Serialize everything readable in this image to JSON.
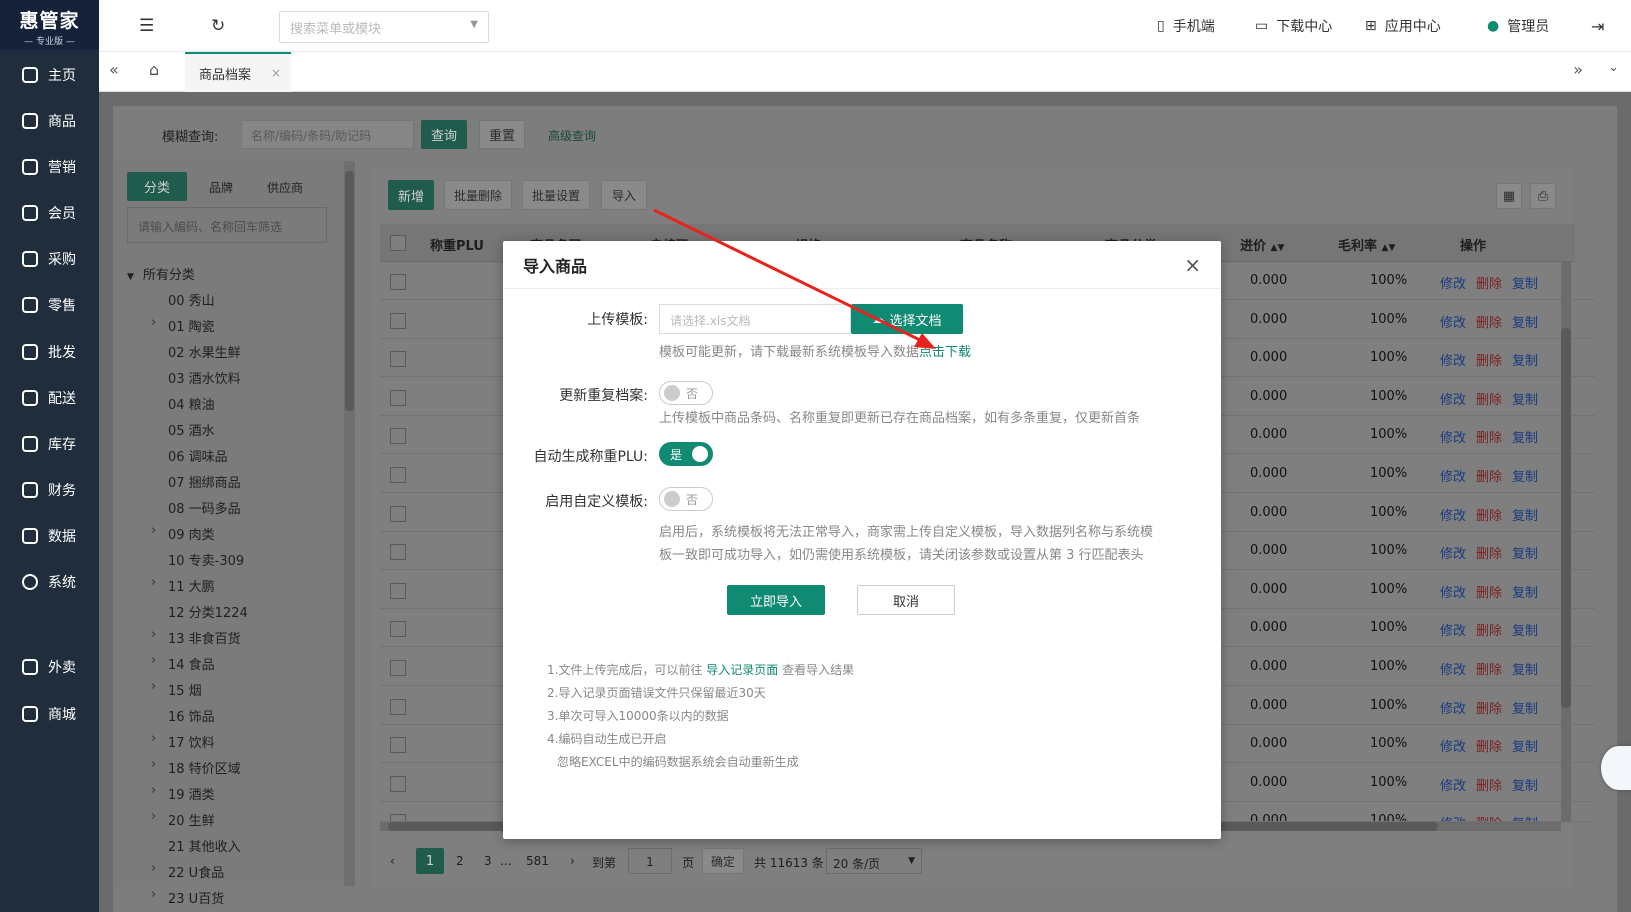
{
  "app": {
    "logo_main": "惠管家",
    "logo_sub": "— 专业版 —"
  },
  "sidebar": {
    "items": [
      {
        "label": "主页",
        "icon": "home-icon"
      },
      {
        "label": "商品",
        "icon": "cube-icon"
      },
      {
        "label": "营销",
        "icon": "chart-icon"
      },
      {
        "label": "会员",
        "icon": "heart-icon"
      },
      {
        "label": "采购",
        "icon": "purchase-icon"
      },
      {
        "label": "零售",
        "icon": "bag-icon"
      },
      {
        "label": "批发",
        "icon": "building-icon"
      },
      {
        "label": "配送",
        "icon": "delivery-icon"
      },
      {
        "label": "库存",
        "icon": "inventory-icon"
      },
      {
        "label": "财务",
        "icon": "finance-icon"
      },
      {
        "label": "数据",
        "icon": "data-icon"
      },
      {
        "label": "系统",
        "icon": "settings-icon"
      },
      {
        "label": "外卖",
        "icon": "bike-icon"
      },
      {
        "label": "商城",
        "icon": "mall-icon"
      }
    ]
  },
  "header": {
    "search_placeholder": "搜索菜单或模块",
    "mobile": "手机端",
    "download": "下载中心",
    "apps": "应用中心",
    "user": "管理员"
  },
  "tabs": {
    "active": "商品档案"
  },
  "filter": {
    "label": "模糊查询:",
    "placeholder": "名称/编码/条码/助记码",
    "query": "查询",
    "reset": "重置",
    "advanced": "高级查询"
  },
  "left_panel": {
    "tabs": [
      "分类",
      "品牌",
      "供应商"
    ],
    "search_placeholder": "请输入编码、名称回车筛选",
    "root": "所有分类",
    "categories": [
      "00 秀山",
      "01 陶瓷",
      "02 水果生鲜",
      "03 酒水饮料",
      "04 粮油",
      "05 酒水",
      "06 调味品",
      "07 捆绑商品",
      "08 一码多品",
      "09 肉类",
      "10 专卖-309",
      "11 大鹏",
      "12 分类1224",
      "13 非食百货",
      "14 食品",
      "15 烟",
      "16 饰品",
      "17 饮料",
      "18 特价区域",
      "19 酒类",
      "20 生鲜",
      "21 其他收入",
      "22 U食品",
      "23 U百货"
    ]
  },
  "toolbar": {
    "add": "新增",
    "batch_delete": "批量删除",
    "batch_set": "批量设置",
    "import": "导入"
  },
  "table": {
    "columns": [
      "称重PLU",
      "商品条码",
      "自编码",
      "规格",
      "商品名称",
      "商品分类",
      "进价",
      "毛利率",
      "操作"
    ],
    "row_cost": "0.000",
    "row_margin": "100%",
    "actions": [
      "修改",
      "删除",
      "复制"
    ]
  },
  "pagination": {
    "pages": [
      "1",
      "2",
      "3",
      "...",
      "581"
    ],
    "goto_label": "到第",
    "goto_value": "1",
    "page_suffix": "页",
    "confirm": "确定",
    "total": "共 11613 条",
    "page_size": "20 条/页"
  },
  "modal": {
    "title": "导入商品",
    "upload_label": "上传模板:",
    "upload_placeholder": "请选择.xls文档",
    "choose_btn": "选择文档",
    "template_hint": "模板可能更新，请下载最新系统模板导入数据",
    "download_link": "点击下载",
    "update_label": "更新重复档案:",
    "update_value": "否",
    "update_hint": "上传模板中商品条码、名称重复即更新已存在商品档案，如有多条重复，仅更新首条",
    "plu_label": "自动生成称重PLU:",
    "plu_value": "是",
    "custom_label": "启用自定义模板:",
    "custom_value": "否",
    "custom_hint_1": "启用后，系统模板将无法正常导入，商家需上传自定义模板，导入数据列名称与系统模",
    "custom_hint_2": "板一致即可成功导入，如仍需使用系统模板，请关闭该参数或设置从第 3 行匹配表头",
    "import_btn": "立即导入",
    "cancel_btn": "取消",
    "note1_pre": "1.文件上传完成后，可以前往",
    "note1_link": "导入记录页面",
    "note1_post": "查看导入结果",
    "note2": "2.导入记录页面错误文件只保留最近30天",
    "note3": "3.单次可导入10000条以内的数据",
    "note4": "4.编码自动生成已开启",
    "note5": "忽略EXCEL中的编码数据系统会自动重新生成"
  },
  "colors": {
    "primary": "#108a72",
    "sidebar": "#1f2d3d",
    "link": "#1a5fd6",
    "delete": "#e03e3e",
    "arrow": "#e8231d"
  }
}
